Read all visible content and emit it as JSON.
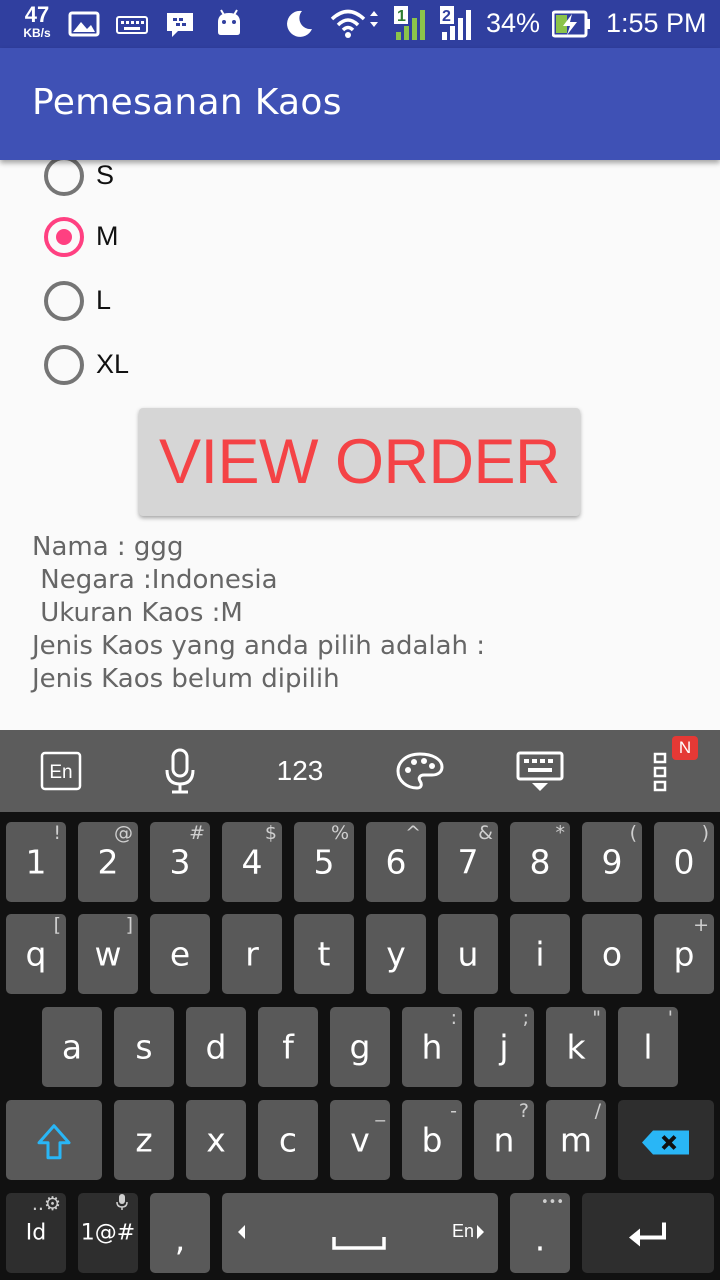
{
  "status_bar": {
    "net_speed": "47",
    "net_unit": "KB/s",
    "sim1": "1",
    "sim2": "2",
    "battery": "34%",
    "time": "1:55 PM",
    "icons": [
      "image-icon",
      "keyboard-icon",
      "bbm-icon",
      "android-icon",
      "moon-icon",
      "wifi-icon",
      "signal-1-icon",
      "signal-2-icon",
      "battery-charging-icon"
    ]
  },
  "app_bar": {
    "title": "Pemesanan Kaos"
  },
  "sizes": {
    "options": [
      "S",
      "M",
      "L",
      "XL"
    ],
    "selected": "M"
  },
  "view_order": {
    "label": "VIEW ORDER"
  },
  "summary": {
    "lines": [
      "Nama : ggg",
      " Negara :Indonesia",
      " Ukuran Kaos :M",
      "Jenis Kaos yang anda pilih adalah :",
      "Jenis Kaos belum dipilih"
    ]
  },
  "keyboard": {
    "toolbar": {
      "lang": "En",
      "numbers": "123",
      "badge": "N",
      "icons": [
        "language-icon",
        "microphone-icon",
        "palette-icon",
        "hide-keyboard-icon",
        "more-icon"
      ]
    },
    "row1": [
      {
        "k": "1",
        "s": "!"
      },
      {
        "k": "2",
        "s": "@"
      },
      {
        "k": "3",
        "s": "#"
      },
      {
        "k": "4",
        "s": "$"
      },
      {
        "k": "5",
        "s": "%"
      },
      {
        "k": "6",
        "s": "^"
      },
      {
        "k": "7",
        "s": "&"
      },
      {
        "k": "8",
        "s": "*"
      },
      {
        "k": "9",
        "s": "("
      },
      {
        "k": "0",
        "s": ")"
      }
    ],
    "row2": [
      {
        "k": "q",
        "s": "["
      },
      {
        "k": "w",
        "s": "]"
      },
      {
        "k": "e",
        "s": ""
      },
      {
        "k": "r",
        "s": ""
      },
      {
        "k": "t",
        "s": ""
      },
      {
        "k": "y",
        "s": ""
      },
      {
        "k": "u",
        "s": ""
      },
      {
        "k": "i",
        "s": ""
      },
      {
        "k": "o",
        "s": ""
      },
      {
        "k": "p",
        "s": "+"
      }
    ],
    "row3": [
      {
        "k": "a",
        "s": ""
      },
      {
        "k": "s",
        "s": ""
      },
      {
        "k": "d",
        "s": ""
      },
      {
        "k": "f",
        "s": ""
      },
      {
        "k": "g",
        "s": ""
      },
      {
        "k": "h",
        "s": ":"
      },
      {
        "k": "j",
        "s": ";"
      },
      {
        "k": "k",
        "s": "\""
      },
      {
        "k": "l",
        "s": "'"
      }
    ],
    "row4": [
      {
        "k": "z",
        "s": ""
      },
      {
        "k": "x",
        "s": ""
      },
      {
        "k": "c",
        "s": ""
      },
      {
        "k": "v",
        "s": "_"
      },
      {
        "k": "b",
        "s": "-"
      },
      {
        "k": "n",
        "s": "?"
      },
      {
        "k": "m",
        "s": "/"
      }
    ],
    "bottom": {
      "id_key": "Id",
      "id_sub": "..⚙",
      "sym_key": "1@#",
      "comma": ",",
      "space_lang": "En",
      "period": ".",
      "period_sub": "•••"
    }
  }
}
